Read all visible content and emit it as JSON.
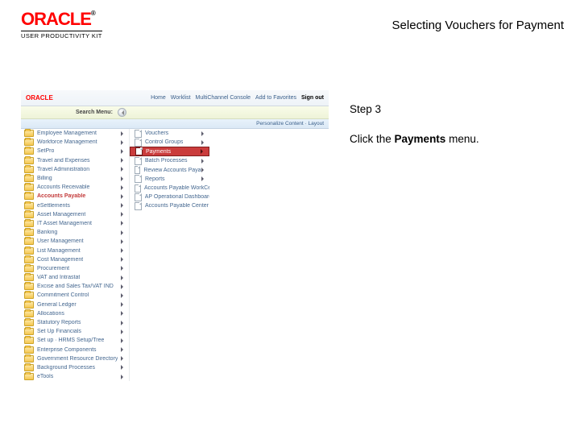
{
  "brand": {
    "logo": "ORACLE",
    "tm": "®",
    "sub": "USER PRODUCTIVITY KIT"
  },
  "page_title": "Selecting Vouchers for Payment",
  "sshot": {
    "logo_small": "ORACLE",
    "topnav": [
      "Home",
      "Worklist",
      "MultiChannel Console",
      "Add to Favorites",
      "Sign out"
    ],
    "search_label": "Search Menu:",
    "personalize": "Personalize Content · Layout",
    "menu_left": [
      "Employee Management",
      "Workforce Management",
      "SetPro",
      "Travel and Expenses",
      "Travel Administration",
      "Billing",
      "Accounts Receivable",
      "Accounts Payable",
      "eSettlements",
      "Asset Management",
      "IT Asset Management",
      "Banking",
      "User Management",
      "List Management",
      "Cost Management",
      "Procurement",
      "VAT and Intrastat",
      "Excise and Sales Tax/VAT IND",
      "Commitment Control",
      "General Ledger",
      "Allocations",
      "Statutory Reports",
      "Set Up Financials",
      "Set up · HRMS Setup/Tree",
      "Enterprise Components",
      "Government Resource Directory",
      "Background Processes",
      "eTools"
    ],
    "selected_index": 7,
    "submenu": [
      "Vouchers",
      "Control Groups",
      "Payments",
      "Batch Processes",
      "Review Accounts Payable Info",
      "Reports",
      "Accounts Payable WorkCenter",
      "AP Operational Dashboard",
      "Accounts Payable Center"
    ],
    "submenu_highlight_index": 2,
    "submenu_carets": [
      0,
      1,
      2,
      3,
      4,
      5
    ]
  },
  "instruction": {
    "step": "Step 3",
    "before": "Click the ",
    "bold": "Payments",
    "after": " menu."
  }
}
